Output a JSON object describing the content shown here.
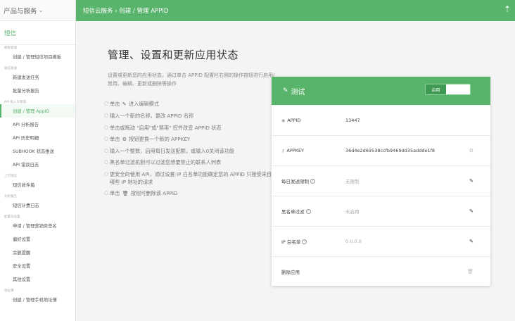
{
  "sidebar": {
    "product_menu": "产品与服务",
    "section_title": "短信",
    "groups": [
      {
        "label": "模板管理",
        "items": [
          {
            "label": "创建 / 管理短信项目模板"
          }
        ]
      },
      {
        "label": "短信发送",
        "items": [
          {
            "label": "新建发送任务"
          },
          {
            "label": "批量分析报告"
          }
        ]
      },
      {
        "label": "API 接入与管理",
        "items": [
          {
            "label": "创建 / 管理 AppID",
            "active": true
          },
          {
            "label": "API 分析报告"
          },
          {
            "label": "API 历史明细"
          },
          {
            "label": "SUBHOOK 状态推送"
          },
          {
            "label": "API 错误日志"
          }
        ]
      },
      {
        "label": "上行短信",
        "items": [
          {
            "label": "短信收件箱"
          }
        ]
      },
      {
        "label": "分析报告",
        "items": [
          {
            "label": "短信计费日志"
          }
        ]
      },
      {
        "label": "配置与设置",
        "items": [
          {
            "label": "申请 / 管理营销类签名"
          },
          {
            "label": "偏好设置"
          },
          {
            "label": "余额提醒"
          },
          {
            "label": "安全设置"
          },
          {
            "label": "其他设置"
          }
        ]
      },
      {
        "label": "地址簿",
        "items": [
          {
            "label": "创建 / 管理手机地址薄"
          }
        ]
      }
    ]
  },
  "topbar": {
    "breadcrumb": "短信云服务 › 创建 / 管理 APPID",
    "up_icon": "arrow-up-icon"
  },
  "main": {
    "title": "管理、设置和更新应用状态",
    "intro": "设置或更新您的应用状态，通过单击 APPID 配置栏右侧的操作按钮进行启用/禁用、编辑、更新或删除等操作",
    "tips": [
      {
        "pre": "单击",
        "icon": "✎",
        "post": "进入编辑模式"
      },
      {
        "pre": "输入一个新的名称，更改 APPID 名称",
        "icon": "",
        "post": ""
      },
      {
        "pre": "单击或拖动 \"启用\"或\"禁用\" 控件改变 APPID 状态",
        "icon": "",
        "post": ""
      },
      {
        "pre": "单击",
        "icon": "⚙",
        "post": "按钮更换一个新的 APPKEY"
      },
      {
        "pre": "输入一个整数，启用每日发送配额，或输入0关闭该功能",
        "icon": "",
        "post": ""
      },
      {
        "pre": "黑名单过滤机制可以过滤您想要禁止的联系人列表",
        "icon": "",
        "post": ""
      },
      {
        "pre": "更安全的使用 API，通过设置 IP 白名单功能确定您的 APPID 只接受来自哪些 IP 地址的请求",
        "icon": "",
        "post": ""
      },
      {
        "pre": "单击",
        "icon": "🗑",
        "post": "按钮可删除该 APPID"
      }
    ]
  },
  "card": {
    "title": "测试",
    "toggle_on_label": "启用",
    "rows": [
      {
        "label": "APPID",
        "value": "13447",
        "muted": false,
        "action": ""
      },
      {
        "label": "APPKEY",
        "value": "36d4e2d69538ccfb9469dd35addde1f8",
        "muted": false,
        "action": "⚙"
      },
      {
        "label": "每日发送限制",
        "value": "无限制",
        "muted": true,
        "action": "✎"
      },
      {
        "label": "黑名单过滤",
        "value": "未启用",
        "muted": true,
        "action": "✎"
      },
      {
        "label": "IP 白名单",
        "value": "0.0.0.0",
        "muted": true,
        "action": "✎"
      },
      {
        "label": "删除应用",
        "value": "",
        "muted": false,
        "action": "🗑"
      }
    ]
  },
  "colors": {
    "accent": "#58b36b",
    "accent_dark": "#3e9952"
  }
}
